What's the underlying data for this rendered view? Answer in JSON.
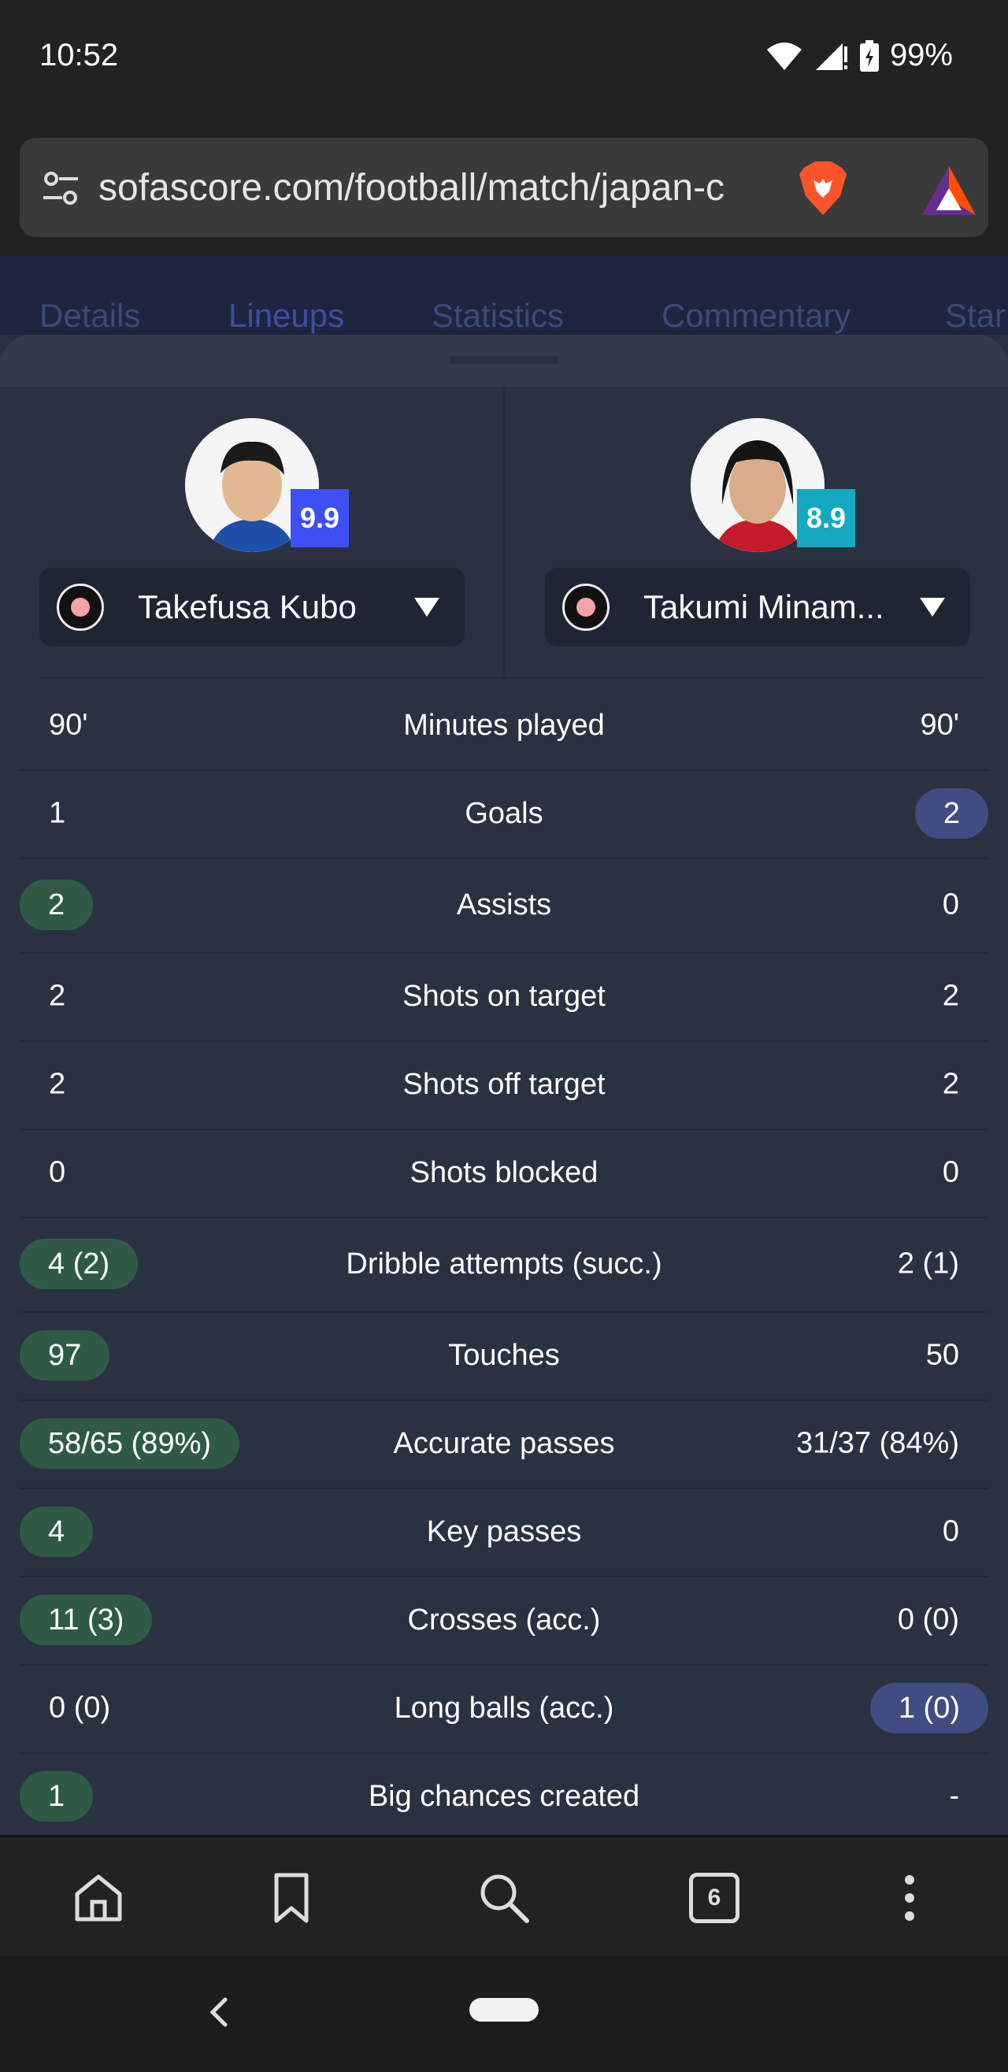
{
  "status": {
    "time": "10:52",
    "battery": "99%"
  },
  "browser": {
    "url": "sofascore.com/football/match/japan-c"
  },
  "bg_tabs": [
    "Details",
    "Lineups",
    "Statistics",
    "Commentary",
    "Star"
  ],
  "players": {
    "left": {
      "name": "Takefusa Kubo",
      "rating": "9.9",
      "rating_color": "#3e50f5"
    },
    "right": {
      "name": "Takumi Minam...",
      "rating": "8.9",
      "rating_color": "#13a9c2"
    }
  },
  "stats": [
    {
      "label": "Minutes played",
      "left": "90'",
      "right": "90'",
      "hl": ""
    },
    {
      "label": "Goals",
      "left": "1",
      "right": "2",
      "hl": "right"
    },
    {
      "label": "Assists",
      "left": "2",
      "right": "0",
      "hl": "left"
    },
    {
      "label": "Shots on target",
      "left": "2",
      "right": "2",
      "hl": ""
    },
    {
      "label": "Shots off target",
      "left": "2",
      "right": "2",
      "hl": ""
    },
    {
      "label": "Shots blocked",
      "left": "0",
      "right": "0",
      "hl": ""
    },
    {
      "label": "Dribble attempts (succ.)",
      "left": "4 (2)",
      "right": "2 (1)",
      "hl": "left"
    },
    {
      "label": "Touches",
      "left": "97",
      "right": "50",
      "hl": "left"
    },
    {
      "label": "Accurate passes",
      "left": "58/65 (89%)",
      "right": "31/37 (84%)",
      "hl": "left"
    },
    {
      "label": "Key passes",
      "left": "4",
      "right": "0",
      "hl": "left"
    },
    {
      "label": "Crosses (acc.)",
      "left": "11 (3)",
      "right": "0 (0)",
      "hl": "left"
    },
    {
      "label": "Long balls (acc.)",
      "left": "0 (0)",
      "right": "1 (0)",
      "hl": "right"
    },
    {
      "label": "Big chances created",
      "left": "1",
      "right": "-",
      "hl": "left"
    }
  ],
  "nav": {
    "tab_count": "6"
  },
  "icons": [
    "wifi-icon",
    "signal-icon",
    "battery-icon",
    "tune-icon",
    "brave-icon",
    "bat-icon",
    "home-icon",
    "bookmark-icon",
    "search-icon",
    "tabs-icon",
    "more-icon",
    "back-icon"
  ]
}
